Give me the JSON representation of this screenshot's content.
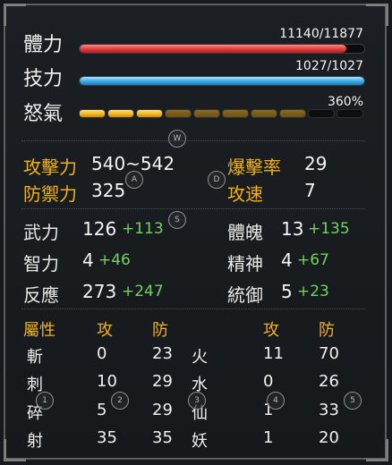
{
  "bars": {
    "hp": {
      "label": "體力",
      "value": "11140/11877",
      "fraction": 0.938
    },
    "skill": {
      "label": "技力",
      "value": "1027/1027",
      "fraction": 1.0
    },
    "rage": {
      "label": "怒氣",
      "value": "360%",
      "segments": [
        "full",
        "full",
        "full",
        "mid",
        "mid",
        "mid",
        "mid",
        "mid",
        "empty",
        "empty"
      ]
    }
  },
  "badges": {
    "w": "W",
    "a": "A",
    "d": "D",
    "s": "S",
    "n1": "1",
    "n2": "2",
    "n3": "3",
    "n4": "4",
    "n5": "5"
  },
  "combat": {
    "attack": {
      "label": "攻擊力",
      "value": "540~542"
    },
    "crit": {
      "label": "爆擊率",
      "value": "29"
    },
    "defense": {
      "label": "防禦力",
      "value": "325"
    },
    "speed": {
      "label": "攻速",
      "value": "7"
    }
  },
  "attributes": {
    "str": {
      "label": "武力",
      "base": "126",
      "bonus": "+113"
    },
    "vit": {
      "label": "體魄",
      "base": "13",
      "bonus": "+135"
    },
    "int": {
      "label": "智力",
      "base": "4",
      "bonus": "+46"
    },
    "spi": {
      "label": "精神",
      "base": "4",
      "bonus": "+67"
    },
    "agi": {
      "label": "反應",
      "base": "273",
      "bonus": "+247"
    },
    "cmd": {
      "label": "統御",
      "base": "5",
      "bonus": "+23"
    }
  },
  "elements": {
    "header": {
      "name": "屬性",
      "atk": "攻",
      "def": "防"
    },
    "left": [
      {
        "name": "斬",
        "atk": "0",
        "def": "23"
      },
      {
        "name": "刺",
        "atk": "10",
        "def": "29"
      },
      {
        "name": "碎",
        "atk": "5",
        "def": "29"
      },
      {
        "name": "射",
        "atk": "35",
        "def": "35"
      }
    ],
    "right": [
      {
        "name": "火",
        "atk": "11",
        "def": "70"
      },
      {
        "name": "水",
        "atk": "0",
        "def": "26"
      },
      {
        "name": "仙",
        "atk": "1",
        "def": "33"
      },
      {
        "name": "妖",
        "atk": "1",
        "def": "20"
      }
    ]
  },
  "colors": {
    "hp": "#e23a3a",
    "skill": "#36a8e6",
    "rage": "#f2b21b",
    "label_gold": "#f2b21b",
    "bonus_green": "#6fd45a"
  }
}
